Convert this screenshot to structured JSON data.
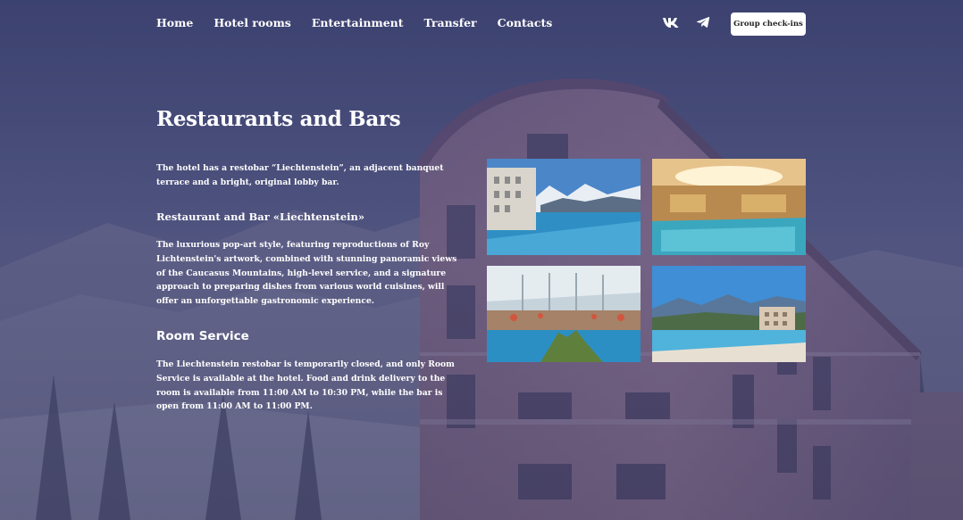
{
  "nav": {
    "items": [
      "Home",
      "Hotel rooms",
      "Entertainment",
      "Transfer",
      "Contacts"
    ],
    "cta_label": "Group check-ins",
    "social_icons": [
      "vk-icon",
      "telegram-icon"
    ]
  },
  "content": {
    "title": "Restaurants and Bars",
    "intro": "The hotel has a restobar “Liechtenstein”, an adjacent banquet terrace and a bright, original lobby bar.",
    "restaurant_heading": "Restaurant and Bar «Liechtenstein»",
    "restaurant_text": "The luxurious pop-art style, featuring reproductions of Roy Lichtenstein's artwork, combined with stunning panoramic views of the Caucasus Mountains, high-level service, and a signature approach to preparing dishes from various world cuisines, will offer an unforgettable gastronomic experience.",
    "room_service_heading": "Room Service",
    "room_service_text": "The Liechtenstein restobar is temporarily closed, and only Room Service is available at the hotel. Food and drink delivery to the room is available from 11:00 AM to 10:30 PM, while the bar is open from 11:00 AM to 11:00 PM."
  },
  "gallery": [
    "outdoor-pool-mountains-photo",
    "indoor-pool-photo",
    "atrium-pool-photo",
    "infinity-pool-valley-photo"
  ],
  "colors": {
    "overlay": "#4b4f73",
    "cta_bg": "#ffffff",
    "text": "#ffffff"
  }
}
